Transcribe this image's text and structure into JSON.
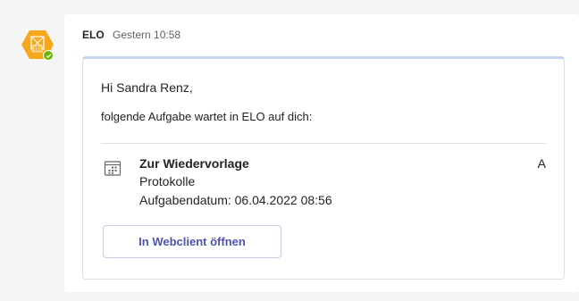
{
  "message": {
    "sender": "ELO",
    "timestamp": "Gestern 10:58",
    "avatar_icon": "elo-logo-icon",
    "avatar_color": "#f5a81c",
    "presence": "available",
    "presence_color": "#6bb700"
  },
  "card": {
    "accent_color": "#c4d3f0",
    "greeting": "Hi Sandra Renz,",
    "intro": "folgende Aufgabe wartet in ELO auf dich:",
    "task": {
      "icon": "calendar-grid-icon",
      "title": "Zur Wiedervorlage",
      "priority": "A",
      "category": "Protokolle",
      "date": "Aufgabendatum: 06.04.2022 08:56"
    },
    "action_button": {
      "label": "In Webclient öffnen",
      "color": "#4f52b2"
    }
  }
}
